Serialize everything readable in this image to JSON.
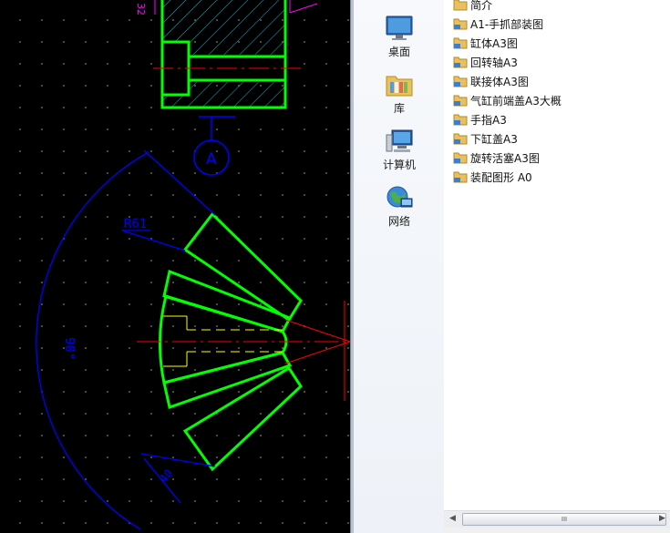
{
  "cad": {
    "dim_radius": "R61",
    "dim_angle": "90°",
    "dim_small": "40",
    "datum_label": "A",
    "dim_top_fragment": "32"
  },
  "nav": {
    "items": [
      {
        "label": "桌面",
        "icon": "desktop-icon"
      },
      {
        "label": "库",
        "icon": "library-icon"
      },
      {
        "label": "计算机",
        "icon": "computer-icon"
      },
      {
        "label": "网络",
        "icon": "network-icon"
      }
    ]
  },
  "files": {
    "items": [
      {
        "name": "简介",
        "icon": "folder-icon"
      },
      {
        "name": "A1-手抓部装图",
        "icon": "shared-folder-icon"
      },
      {
        "name": "缸体A3图",
        "icon": "shared-folder-icon"
      },
      {
        "name": "回转轴A3",
        "icon": "shared-folder-icon"
      },
      {
        "name": "联接体A3图",
        "icon": "shared-folder-icon"
      },
      {
        "name": "气缸前端盖A3大概",
        "icon": "shared-folder-icon"
      },
      {
        "name": "手指A3",
        "icon": "shared-folder-icon"
      },
      {
        "name": "下缸盖A3",
        "icon": "shared-folder-icon"
      },
      {
        "name": "旋转活塞A3图",
        "icon": "shared-folder-icon"
      },
      {
        "name": "装配图形 A0",
        "icon": "shared-folder-icon"
      }
    ]
  },
  "scrollbar": {
    "left_arrow": "◀",
    "right_arrow": "▶",
    "grip": "III"
  },
  "colors": {
    "cad_bg": "#000000",
    "outline": "#00ff00",
    "dimension": "#0000ff",
    "centerline": "#ff0000",
    "hatch": "#00bcd4",
    "hidden": "#ffff00"
  }
}
